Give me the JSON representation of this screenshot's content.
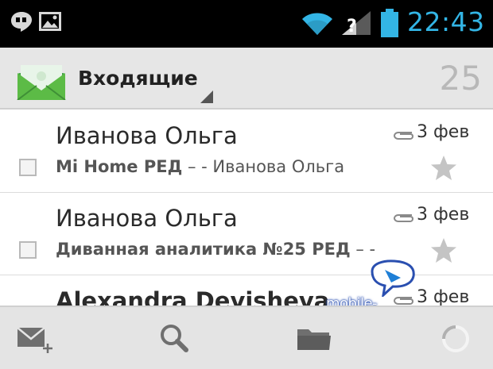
{
  "status_bar": {
    "time": "22:43",
    "icons": [
      "hangouts-icon",
      "gallery-icon",
      "wifi-icon",
      "signal-icon",
      "battery-icon"
    ],
    "accent_color": "#33b5e5"
  },
  "action_bar": {
    "app_icon": "gmail-envelope-icon",
    "folder_label": "Входящие",
    "unread_count": "25"
  },
  "messages": [
    {
      "sender": "Иванова Ольга",
      "subject": "Mi Home РЕД",
      "snippet": " – - Иванова Ольга",
      "date": "3 фев",
      "has_attachment": true,
      "starred": false
    },
    {
      "sender": "Иванова Ольга",
      "subject": "Диванная аналитика №25 РЕД",
      "snippet": " – -",
      "date": "3 фев",
      "has_attachment": true,
      "starred": false
    },
    {
      "sender": "Alexandra Devisheva",
      "subject": "",
      "snippet": "",
      "date": "3 фев",
      "has_attachment": true,
      "starred": false
    }
  ],
  "watermark": {
    "text": "mobile-review.com"
  },
  "bottom_bar": {
    "icons": [
      "compose-icon",
      "search-icon",
      "folder-icon",
      "refresh-icon"
    ]
  }
}
